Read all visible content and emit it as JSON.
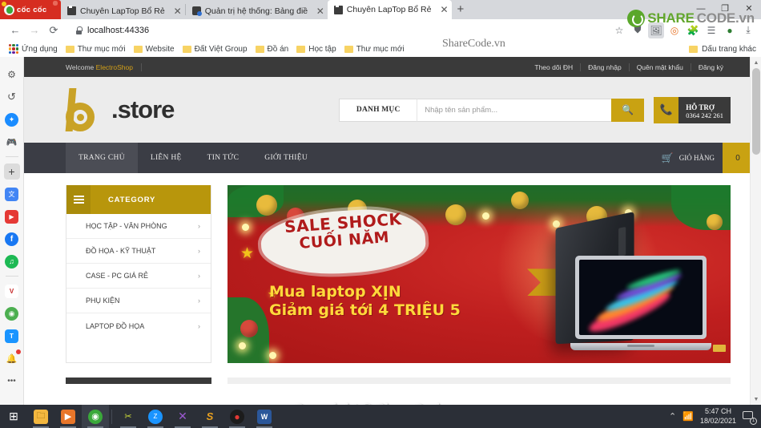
{
  "browser": {
    "brand": "cốc cốc",
    "tabs": [
      {
        "title": "Chuyên LapTop Bổ Rẻ",
        "active": false,
        "icon": "document-icon"
      },
      {
        "title": "Quản trị hệ thống: Bảng điều",
        "active": false,
        "icon": "admin-icon"
      },
      {
        "title": "Chuyên LapTop Bổ Rẻ",
        "active": true,
        "icon": "document-icon"
      }
    ],
    "new_tab_label": "+",
    "window_controls": {
      "minimize": "—",
      "maximize": "❐",
      "close": "✕"
    },
    "nav": {
      "back": "←",
      "forward": "→",
      "reload": "⟳"
    },
    "address": {
      "value": "localhost:44336",
      "lock": "lock-icon"
    },
    "toolbar_icons": [
      "star-icon",
      "shield-icon",
      "extension-photo-icon",
      "coccoc-icon",
      "puzzle-icon",
      "playlist-icon",
      "avatar-icon",
      "download-icon"
    ],
    "bookmarks": [
      "Ứng dụng",
      "Thư mục mới",
      "Website",
      "Đất Việt Group",
      "Đồ án",
      "Học tập",
      "Thư mục mới"
    ],
    "other_bookmarks": "Dấu trang khác"
  },
  "sidebar": {
    "items": [
      {
        "name": "gear-icon",
        "glyph": "⚙",
        "color": "#5a5a5a",
        "bg": "transparent"
      },
      {
        "name": "history-icon",
        "glyph": "↺",
        "color": "#5a5a5a",
        "bg": "transparent"
      },
      {
        "name": "messenger-icon",
        "glyph": "✦",
        "color": "#ffffff",
        "bg": "#1a8cff"
      },
      {
        "name": "game-controller-icon",
        "glyph": "🎮",
        "color": "#4caf50",
        "bg": "transparent"
      },
      {
        "name": "add-icon",
        "glyph": "+",
        "color": "#444444",
        "bg": "#dcdcdc"
      },
      {
        "name": "translate-icon",
        "glyph": "文",
        "color": "#ffffff",
        "bg": "#4285f4"
      },
      {
        "name": "youtube-icon",
        "glyph": "▶",
        "color": "#ffffff",
        "bg": "#e53935"
      },
      {
        "name": "facebook-icon",
        "glyph": "f",
        "color": "#ffffff",
        "bg": "#1877f2"
      },
      {
        "name": "spotify-icon",
        "glyph": "♫",
        "color": "#ffffff",
        "bg": "#1db954"
      },
      {
        "name": "vtv-icon",
        "glyph": "V",
        "color": "#c62828",
        "bg": "#ffffff"
      },
      {
        "name": "shopee-icon",
        "glyph": "◉",
        "color": "#ffffff",
        "bg": "#4caf50"
      },
      {
        "name": "tiki-icon",
        "glyph": "T",
        "color": "#ffffff",
        "bg": "#1a94ff"
      },
      {
        "name": "bell-icon",
        "glyph": "🔔",
        "color": "#5a5a5a",
        "bg": "transparent"
      },
      {
        "name": "more-icon",
        "glyph": "•••",
        "color": "#5a5a5a",
        "bg": "transparent"
      }
    ]
  },
  "site": {
    "topbar": {
      "welcome_prefix": "Welcome ",
      "welcome_brand": "ElectroShop",
      "links": [
        "Theo dõi ĐH",
        "Đăng nhập",
        "Quên mật khẩu",
        "Đăng ký"
      ]
    },
    "logo_text": ".store",
    "search": {
      "category_label": "DANH MỤC",
      "placeholder": "Nhập tên sản phẩm...",
      "button_icon": "search-icon"
    },
    "support": {
      "icon": "phone-icon",
      "title": "HỖ TRỢ",
      "phone": "0364 242 261"
    },
    "nav": [
      {
        "label": "TRANG CHỦ",
        "active": true
      },
      {
        "label": "LIÊN HỆ",
        "active": false
      },
      {
        "label": "TIN TỨC",
        "active": false
      },
      {
        "label": "GIỚI THIỆU",
        "active": false
      }
    ],
    "cart": {
      "icon": "cart-icon",
      "label": "GIỎ HÀNG",
      "count": "0"
    },
    "category": {
      "header": "CATEGORY",
      "menu_icon": "hamburger-icon",
      "items": [
        {
          "label": "HỌC TẬP - VĂN PHÒNG",
          "chevron": "›"
        },
        {
          "label": "ĐỒ HỌA - KỸ THUẬT",
          "chevron": "›"
        },
        {
          "label": "CASE - PC GIÁ RẺ",
          "chevron": "›"
        },
        {
          "label": "PHỤ KIỆN",
          "chevron": "›"
        },
        {
          "label": "LAPTOP ĐỒ HỌA",
          "chevron": "›"
        }
      ]
    },
    "banner": {
      "brush_line1": "SALE SHOCK",
      "brush_line2": "CUỐI NĂM",
      "headline1": "Mua laptop XỊN",
      "headline2": "Giảm giá tới 4 TRIỆU 5"
    },
    "colors": {
      "gold": "#c9a212",
      "dark": "#3a3a3a",
      "nav_dark": "#3b3d45",
      "category_gold": "#b8960c",
      "banner_red": "#bf1f1f"
    }
  },
  "watermarks": {
    "top": "ShareCode.vn",
    "logo_share": "SHARE",
    "logo_code": "CODE.vn",
    "center": "Copyright © ShareCode.vn"
  },
  "taskbar": {
    "items": [
      {
        "name": "start-button",
        "glyph": "⊞",
        "bg": "transparent",
        "color": "#ffffff",
        "running": false
      },
      {
        "name": "file-explorer",
        "glyph": "🗀",
        "bg": "#f3b73f",
        "color": "#8a5d00",
        "running": true
      },
      {
        "name": "media-player",
        "glyph": "▶",
        "bg": "#e8762a",
        "color": "#ffffff",
        "running": true
      },
      {
        "name": "coccoc-browser",
        "glyph": "◉",
        "bg": "#3aa93a",
        "color": "#ffffff",
        "running": true,
        "active": true
      },
      {
        "name": "tools-app",
        "glyph": "✂",
        "bg": "transparent",
        "color": "#cddc39",
        "running": true
      },
      {
        "name": "zalo-app",
        "glyph": "Z",
        "bg": "#1a94ff",
        "color": "#ffffff",
        "running": true
      },
      {
        "name": "visual-studio-code",
        "glyph": "✕",
        "bg": "transparent",
        "color": "#9b59d0",
        "running": true
      },
      {
        "name": "sublime-text",
        "glyph": "S",
        "bg": "transparent",
        "color": "#e8a020",
        "running": true
      },
      {
        "name": "screen-recorder",
        "glyph": "●",
        "bg": "#1c1c1c",
        "color": "#e53935",
        "running": true
      },
      {
        "name": "microsoft-word",
        "glyph": "W",
        "bg": "#2b579a",
        "color": "#ffffff",
        "running": true
      }
    ],
    "tray": {
      "chevron": "⌃",
      "wifi_icon": "wifi-icon",
      "time": "5:47 CH",
      "date": "18/02/2021",
      "notification_count": "1"
    }
  }
}
